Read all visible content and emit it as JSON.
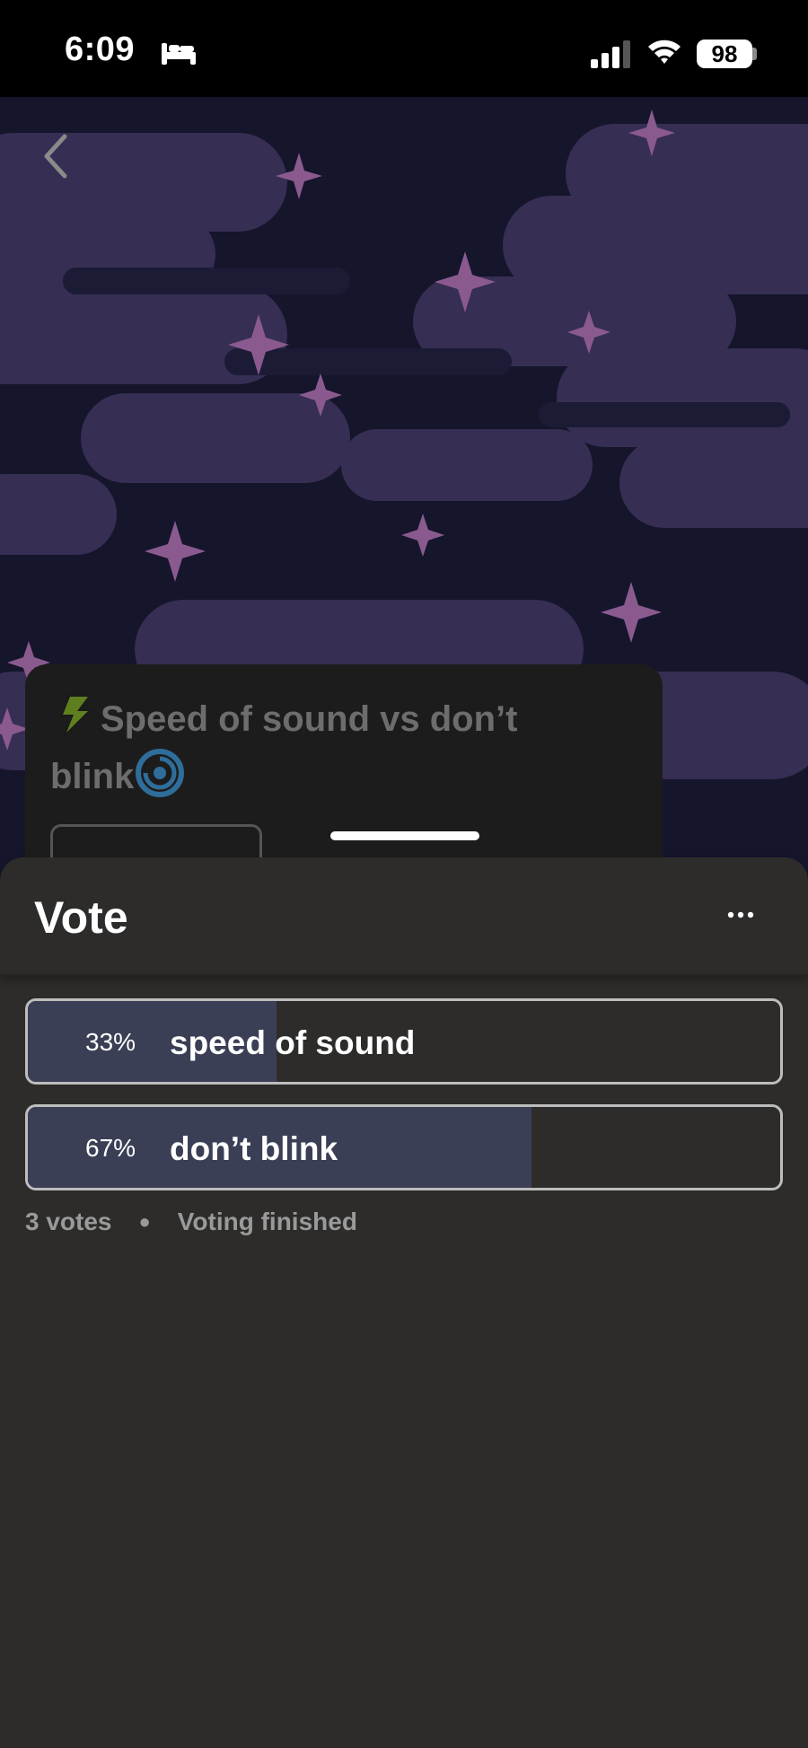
{
  "status_bar": {
    "time": "6:09",
    "battery": "98",
    "icons": [
      "bed-icon",
      "signal-icon",
      "wifi-icon",
      "battery-icon"
    ]
  },
  "post": {
    "title": "Speed of sound vs don’t blink",
    "title_part1": "Speed of sound vs don’t",
    "title_part2": "blink",
    "icons": [
      "lightning-bolt-icon",
      "swirl-eye-icon"
    ]
  },
  "sheet": {
    "title": "Vote",
    "more_icon": "ellipsis-icon"
  },
  "poll": {
    "options": [
      {
        "percent_label": "33%",
        "label": "speed of sound",
        "fraction": 0.33
      },
      {
        "percent_label": "67%",
        "label": "don’t blink",
        "fraction": 0.67
      }
    ],
    "votes": "3 votes",
    "status": "Voting finished"
  },
  "colors": {
    "sheet_bg": "#2d2c2a",
    "bar_fill": "#3b3f55",
    "sky": "#15152b",
    "cloud": "#3a3158",
    "star": "#8a5a8f"
  }
}
